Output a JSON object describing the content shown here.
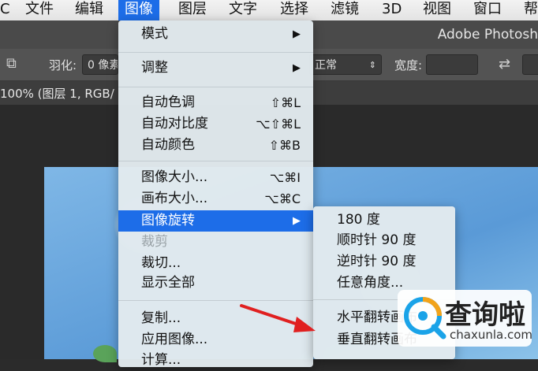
{
  "menubar": {
    "items": [
      {
        "label": "C"
      },
      {
        "label": "文件"
      },
      {
        "label": "编辑"
      },
      {
        "label": "图像"
      },
      {
        "label": "图层"
      },
      {
        "label": "文字"
      },
      {
        "label": "选择"
      },
      {
        "label": "滤镜"
      },
      {
        "label": "3D"
      },
      {
        "label": "视图"
      },
      {
        "label": "窗口"
      },
      {
        "label": "帮"
      }
    ]
  },
  "app": {
    "title": "Adobe Photosh"
  },
  "options": {
    "feather_label": "羽化:",
    "feather_value": "0 像素",
    "mode_value": "正常",
    "width_label": "宽度:",
    "width_value": ""
  },
  "doc": {
    "tab_label": "100% (图层 1, RGB/"
  },
  "image_menu": {
    "items": [
      {
        "label": "模式",
        "submenu": true
      },
      {
        "label": "调整",
        "submenu": true
      },
      {
        "label": "自动色调",
        "shortcut": "⇧⌘L"
      },
      {
        "label": "自动对比度",
        "shortcut": "⌥⇧⌘L"
      },
      {
        "label": "自动颜色",
        "shortcut": "⇧⌘B"
      },
      {
        "label": "图像大小...",
        "shortcut": "⌥⌘I"
      },
      {
        "label": "画布大小...",
        "shortcut": "⌥⌘C"
      },
      {
        "label": "图像旋转",
        "submenu": true,
        "highlighted": true
      },
      {
        "label": "裁剪",
        "disabled": true
      },
      {
        "label": "裁切..."
      },
      {
        "label": "显示全部"
      },
      {
        "label": "复制..."
      },
      {
        "label": "应用图像..."
      },
      {
        "label": "计算..."
      }
    ]
  },
  "rotate_submenu": {
    "items": [
      {
        "label": "180 度"
      },
      {
        "label": "顺时针 90 度"
      },
      {
        "label": "逆时针 90 度"
      },
      {
        "label": "任意角度..."
      },
      {
        "label": "水平翻转画布"
      },
      {
        "label": "垂直翻转画布"
      }
    ]
  },
  "watermark": {
    "text_cn": "查询啦",
    "text_en": "chaxunla.com"
  },
  "colors": {
    "highlight": "#1d6de8",
    "arrow_red": "#e02020",
    "menu_bg": "#e2eaee",
    "canvas_blue": "#6fa9dd"
  }
}
